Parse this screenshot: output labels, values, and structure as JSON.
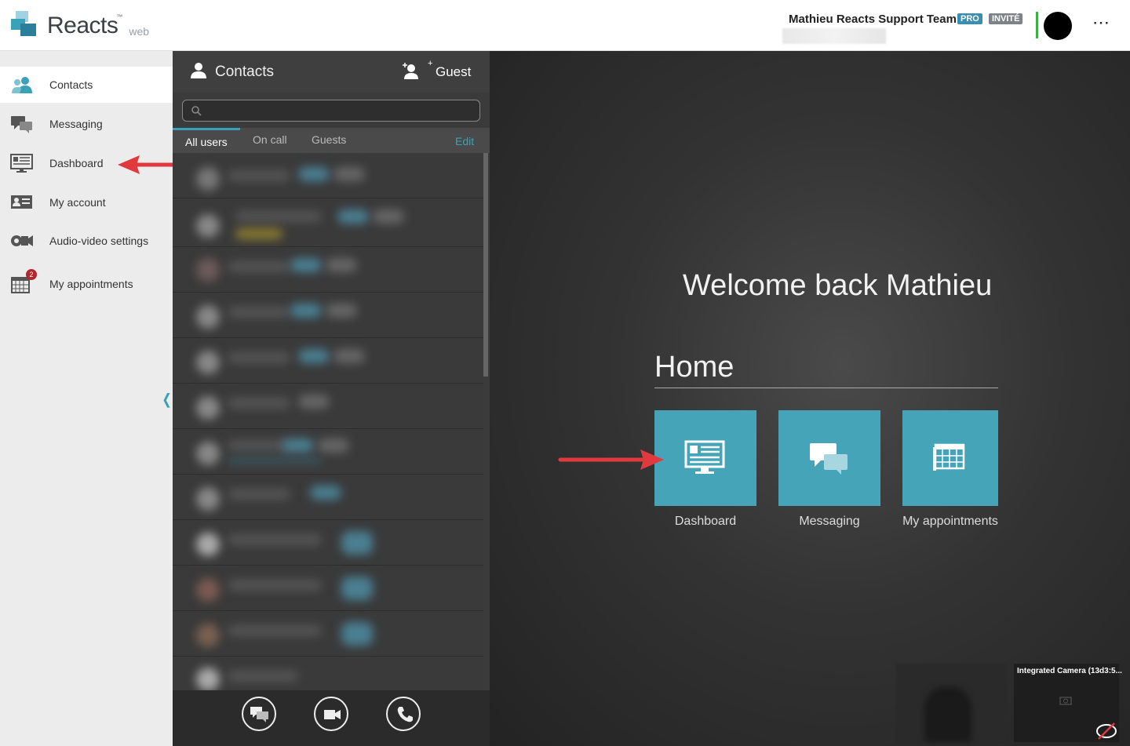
{
  "header": {
    "logo_text": "Reacts",
    "logo_sub": "web",
    "logo_tm": "™",
    "team_name": "Mathieu Reacts Support Team",
    "badge_pro": "PRO",
    "badge_invite": "INVITÉ",
    "more_label": "⋯"
  },
  "nav": {
    "items": [
      {
        "label": "Contacts"
      },
      {
        "label": "Messaging"
      },
      {
        "label": "Dashboard"
      },
      {
        "label": "My account"
      },
      {
        "label": "Audio-video settings"
      },
      {
        "label": "My appointments"
      }
    ],
    "appointments_badge": "2",
    "collapse_label": "❬"
  },
  "contacts": {
    "title": "Contacts",
    "guest_label": "Guest",
    "search_placeholder": "",
    "tabs": [
      "All users",
      "On call",
      "Guests"
    ],
    "edit_label": "Edit"
  },
  "main": {
    "welcome": "Welcome back Mathieu",
    "home_title": "Home",
    "tiles": [
      {
        "label": "Dashboard"
      },
      {
        "label": "Messaging"
      },
      {
        "label": "My appointments"
      }
    ]
  },
  "video": {
    "camera_label": "Integrated Camera (13d3:5..."
  },
  "colors": {
    "accent": "#45a4b8",
    "presence": "#3fae49",
    "arrow": "#e0393e"
  }
}
